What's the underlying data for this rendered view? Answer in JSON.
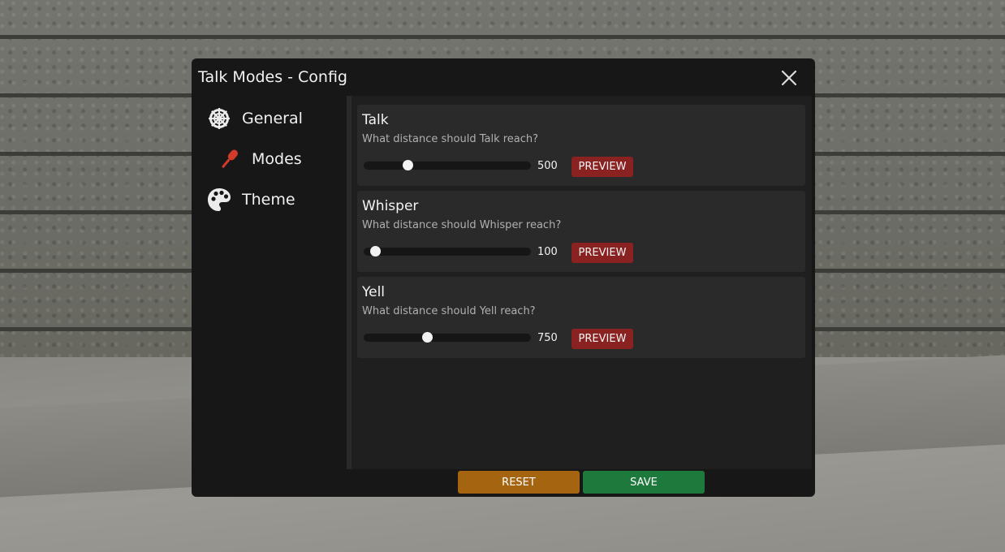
{
  "window": {
    "title": "Talk Modes - Config"
  },
  "sidebar": {
    "items": [
      {
        "label": "General",
        "icon": "gear-icon"
      },
      {
        "label": "Modes",
        "icon": "microphone-icon"
      },
      {
        "label": "Theme",
        "icon": "palette-icon"
      }
    ]
  },
  "modes": [
    {
      "name": "Talk",
      "description": "What distance should Talk reach?",
      "value": "500",
      "slider_fraction": 0.26,
      "preview_label": "PREVIEW"
    },
    {
      "name": "Whisper",
      "description": "What distance should Whisper reach?",
      "value": "100",
      "slider_fraction": 0.07,
      "preview_label": "PREVIEW"
    },
    {
      "name": "Yell",
      "description": "What distance should Yell reach?",
      "value": "750",
      "slider_fraction": 0.38,
      "preview_label": "PREVIEW"
    }
  ],
  "footer": {
    "reset_label": "RESET",
    "save_label": "SAVE"
  },
  "colors": {
    "preview": "#8a2222",
    "reset": "#a56410",
    "save": "#1e7a3c",
    "microphone": "#d23a2a"
  }
}
